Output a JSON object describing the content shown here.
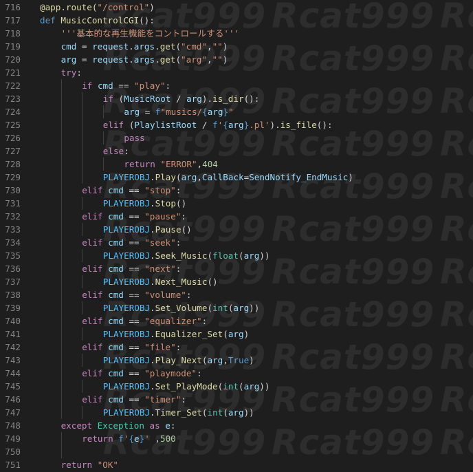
{
  "editor": {
    "language": "python",
    "watermark_text": "Rcat999",
    "colors": {
      "background": "#1e1e1e",
      "line_number": "#858585",
      "keyword": "#c586c0",
      "keyword_blue": "#569cd6",
      "function": "#dcdcaa",
      "class": "#4ec9b0",
      "variable": "#9cdcfe",
      "constant": "#4fc1ff",
      "string": "#ce9178",
      "number": "#b5cea8",
      "plain": "#d4d4d4"
    },
    "lines": [
      {
        "n": "716",
        "indent": 0,
        "tokens": [
          {
            "t": "@app.route(",
            "c": "dec"
          },
          {
            "t": "\"/control\"",
            "c": "str"
          },
          {
            "t": ")",
            "c": "op"
          }
        ]
      },
      {
        "n": "717",
        "indent": 0,
        "tokens": [
          {
            "t": "def ",
            "c": "kwb"
          },
          {
            "t": "MusicControlCGI",
            "c": "fn"
          },
          {
            "t": "():",
            "c": "op"
          }
        ]
      },
      {
        "n": "718",
        "indent": 1,
        "tokens": [
          {
            "t": "'''基本的な再生機能をコントロールする'''",
            "c": "str"
          }
        ]
      },
      {
        "n": "719",
        "indent": 1,
        "tokens": [
          {
            "t": "cmd",
            "c": "var"
          },
          {
            "t": " = ",
            "c": "op"
          },
          {
            "t": "request",
            "c": "var"
          },
          {
            "t": ".",
            "c": "op"
          },
          {
            "t": "args",
            "c": "var"
          },
          {
            "t": ".",
            "c": "op"
          },
          {
            "t": "get",
            "c": "fn"
          },
          {
            "t": "(",
            "c": "op"
          },
          {
            "t": "\"cmd\"",
            "c": "str"
          },
          {
            "t": ",",
            "c": "op"
          },
          {
            "t": "\"\"",
            "c": "str"
          },
          {
            "t": ")",
            "c": "op"
          }
        ]
      },
      {
        "n": "720",
        "indent": 1,
        "tokens": [
          {
            "t": "arg",
            "c": "var"
          },
          {
            "t": " = ",
            "c": "op"
          },
          {
            "t": "request",
            "c": "var"
          },
          {
            "t": ".",
            "c": "op"
          },
          {
            "t": "args",
            "c": "var"
          },
          {
            "t": ".",
            "c": "op"
          },
          {
            "t": "get",
            "c": "fn"
          },
          {
            "t": "(",
            "c": "op"
          },
          {
            "t": "\"arg\"",
            "c": "str"
          },
          {
            "t": ",",
            "c": "op"
          },
          {
            "t": "\"\"",
            "c": "str"
          },
          {
            "t": ")",
            "c": "op"
          }
        ]
      },
      {
        "n": "721",
        "indent": 1,
        "tokens": [
          {
            "t": "try",
            "c": "kw"
          },
          {
            "t": ":",
            "c": "op"
          }
        ]
      },
      {
        "n": "722",
        "indent": 2,
        "tokens": [
          {
            "t": "if ",
            "c": "kw"
          },
          {
            "t": "cmd",
            "c": "var"
          },
          {
            "t": " == ",
            "c": "op"
          },
          {
            "t": "\"play\"",
            "c": "str"
          },
          {
            "t": ":",
            "c": "op"
          }
        ]
      },
      {
        "n": "723",
        "indent": 3,
        "tokens": [
          {
            "t": "if ",
            "c": "kw"
          },
          {
            "t": "(",
            "c": "op"
          },
          {
            "t": "MusicRoot",
            "c": "var"
          },
          {
            "t": " / ",
            "c": "op"
          },
          {
            "t": "arg",
            "c": "var"
          },
          {
            "t": ").",
            "c": "op"
          },
          {
            "t": "is_dir",
            "c": "fn"
          },
          {
            "t": "():",
            "c": "op"
          }
        ]
      },
      {
        "n": "724",
        "indent": 4,
        "tokens": [
          {
            "t": "arg",
            "c": "var"
          },
          {
            "t": " = ",
            "c": "op"
          },
          {
            "t": "f",
            "c": "kwb"
          },
          {
            "t": "\"musics/",
            "c": "str"
          },
          {
            "t": "{",
            "c": "kwb"
          },
          {
            "t": "arg",
            "c": "var"
          },
          {
            "t": "}",
            "c": "kwb"
          },
          {
            "t": "\"",
            "c": "str"
          }
        ]
      },
      {
        "n": "725",
        "indent": 3,
        "tokens": [
          {
            "t": "elif ",
            "c": "kw"
          },
          {
            "t": "(",
            "c": "op"
          },
          {
            "t": "PlaylistRoot",
            "c": "var"
          },
          {
            "t": " / ",
            "c": "op"
          },
          {
            "t": "f",
            "c": "kwb"
          },
          {
            "t": "'",
            "c": "str"
          },
          {
            "t": "{",
            "c": "kwb"
          },
          {
            "t": "arg",
            "c": "var"
          },
          {
            "t": "}",
            "c": "kwb"
          },
          {
            "t": ".pl'",
            "c": "str"
          },
          {
            "t": ").",
            "c": "op"
          },
          {
            "t": "is_file",
            "c": "fn"
          },
          {
            "t": "():",
            "c": "op"
          }
        ]
      },
      {
        "n": "726",
        "indent": 4,
        "tokens": [
          {
            "t": "pass",
            "c": "kw"
          }
        ]
      },
      {
        "n": "727",
        "indent": 3,
        "tokens": [
          {
            "t": "else",
            "c": "kw"
          },
          {
            "t": ":",
            "c": "op"
          }
        ]
      },
      {
        "n": "728",
        "indent": 4,
        "tokens": [
          {
            "t": "return ",
            "c": "kw"
          },
          {
            "t": "\"ERROR\"",
            "c": "str"
          },
          {
            "t": ",",
            "c": "op"
          },
          {
            "t": "404",
            "c": "num"
          }
        ]
      },
      {
        "n": "729",
        "indent": 3,
        "tokens": [
          {
            "t": "PLAYEROBJ",
            "c": "const"
          },
          {
            "t": ".",
            "c": "op"
          },
          {
            "t": "Play",
            "c": "fn"
          },
          {
            "t": "(",
            "c": "op"
          },
          {
            "t": "arg",
            "c": "var"
          },
          {
            "t": ",",
            "c": "op"
          },
          {
            "t": "CallBack",
            "c": "var"
          },
          {
            "t": "=",
            "c": "op"
          },
          {
            "t": "SendNotify_EndMusic",
            "c": "var"
          },
          {
            "t": ")",
            "c": "op"
          }
        ]
      },
      {
        "n": "730",
        "indent": 2,
        "tokens": [
          {
            "t": "elif ",
            "c": "kw"
          },
          {
            "t": "cmd",
            "c": "var"
          },
          {
            "t": " == ",
            "c": "op"
          },
          {
            "t": "\"stop\"",
            "c": "str"
          },
          {
            "t": ":",
            "c": "op"
          }
        ]
      },
      {
        "n": "731",
        "indent": 3,
        "tokens": [
          {
            "t": "PLAYEROBJ",
            "c": "const"
          },
          {
            "t": ".",
            "c": "op"
          },
          {
            "t": "Stop",
            "c": "fn"
          },
          {
            "t": "()",
            "c": "op"
          }
        ]
      },
      {
        "n": "732",
        "indent": 2,
        "tokens": [
          {
            "t": "elif ",
            "c": "kw"
          },
          {
            "t": "cmd",
            "c": "var"
          },
          {
            "t": " == ",
            "c": "op"
          },
          {
            "t": "\"pause\"",
            "c": "str"
          },
          {
            "t": ":",
            "c": "op"
          }
        ]
      },
      {
        "n": "733",
        "indent": 3,
        "tokens": [
          {
            "t": "PLAYEROBJ",
            "c": "const"
          },
          {
            "t": ".",
            "c": "op"
          },
          {
            "t": "Pause",
            "c": "fn"
          },
          {
            "t": "()",
            "c": "op"
          }
        ]
      },
      {
        "n": "734",
        "indent": 2,
        "tokens": [
          {
            "t": "elif ",
            "c": "kw"
          },
          {
            "t": "cmd",
            "c": "var"
          },
          {
            "t": " == ",
            "c": "op"
          },
          {
            "t": "\"seek\"",
            "c": "str"
          },
          {
            "t": ":",
            "c": "op"
          }
        ]
      },
      {
        "n": "735",
        "indent": 3,
        "tokens": [
          {
            "t": "PLAYEROBJ",
            "c": "const"
          },
          {
            "t": ".",
            "c": "op"
          },
          {
            "t": "Seek_Music",
            "c": "fn"
          },
          {
            "t": "(",
            "c": "op"
          },
          {
            "t": "float",
            "c": "cls"
          },
          {
            "t": "(",
            "c": "op"
          },
          {
            "t": "arg",
            "c": "var"
          },
          {
            "t": "))",
            "c": "op"
          }
        ]
      },
      {
        "n": "736",
        "indent": 2,
        "tokens": [
          {
            "t": "elif ",
            "c": "kw"
          },
          {
            "t": "cmd",
            "c": "var"
          },
          {
            "t": " == ",
            "c": "op"
          },
          {
            "t": "\"next\"",
            "c": "str"
          },
          {
            "t": ":",
            "c": "op"
          }
        ]
      },
      {
        "n": "737",
        "indent": 3,
        "tokens": [
          {
            "t": "PLAYEROBJ",
            "c": "const"
          },
          {
            "t": ".",
            "c": "op"
          },
          {
            "t": "Next_Music",
            "c": "fn"
          },
          {
            "t": "()",
            "c": "op"
          }
        ]
      },
      {
        "n": "738",
        "indent": 2,
        "tokens": [
          {
            "t": "elif ",
            "c": "kw"
          },
          {
            "t": "cmd",
            "c": "var"
          },
          {
            "t": " == ",
            "c": "op"
          },
          {
            "t": "\"volume\"",
            "c": "str"
          },
          {
            "t": ":",
            "c": "op"
          }
        ]
      },
      {
        "n": "739",
        "indent": 3,
        "tokens": [
          {
            "t": "PLAYEROBJ",
            "c": "const"
          },
          {
            "t": ".",
            "c": "op"
          },
          {
            "t": "Set_Volume",
            "c": "fn"
          },
          {
            "t": "(",
            "c": "op"
          },
          {
            "t": "int",
            "c": "cls"
          },
          {
            "t": "(",
            "c": "op"
          },
          {
            "t": "arg",
            "c": "var"
          },
          {
            "t": "))",
            "c": "op"
          }
        ]
      },
      {
        "n": "740",
        "indent": 2,
        "tokens": [
          {
            "t": "elif ",
            "c": "kw"
          },
          {
            "t": "cmd",
            "c": "var"
          },
          {
            "t": " == ",
            "c": "op"
          },
          {
            "t": "\"equalizer\"",
            "c": "str"
          },
          {
            "t": ":",
            "c": "op"
          }
        ]
      },
      {
        "n": "741",
        "indent": 3,
        "tokens": [
          {
            "t": "PLAYEROBJ",
            "c": "const"
          },
          {
            "t": ".",
            "c": "op"
          },
          {
            "t": "Equalizer_Set",
            "c": "fn"
          },
          {
            "t": "(",
            "c": "op"
          },
          {
            "t": "arg",
            "c": "var"
          },
          {
            "t": ")",
            "c": "op"
          }
        ]
      },
      {
        "n": "742",
        "indent": 2,
        "tokens": [
          {
            "t": "elif ",
            "c": "kw"
          },
          {
            "t": "cmd",
            "c": "var"
          },
          {
            "t": " == ",
            "c": "op"
          },
          {
            "t": "\"file\"",
            "c": "str"
          },
          {
            "t": ":",
            "c": "op"
          }
        ]
      },
      {
        "n": "743",
        "indent": 3,
        "tokens": [
          {
            "t": "PLAYEROBJ",
            "c": "const"
          },
          {
            "t": ".",
            "c": "op"
          },
          {
            "t": "Play_Next",
            "c": "fn"
          },
          {
            "t": "(",
            "c": "op"
          },
          {
            "t": "arg",
            "c": "var"
          },
          {
            "t": ",",
            "c": "op"
          },
          {
            "t": "True",
            "c": "kwb"
          },
          {
            "t": ")",
            "c": "op"
          }
        ]
      },
      {
        "n": "744",
        "indent": 2,
        "tokens": [
          {
            "t": "elif ",
            "c": "kw"
          },
          {
            "t": "cmd",
            "c": "var"
          },
          {
            "t": " == ",
            "c": "op"
          },
          {
            "t": "\"playmode\"",
            "c": "str"
          },
          {
            "t": ":",
            "c": "op"
          }
        ]
      },
      {
        "n": "745",
        "indent": 3,
        "tokens": [
          {
            "t": "PLAYEROBJ",
            "c": "const"
          },
          {
            "t": ".",
            "c": "op"
          },
          {
            "t": "Set_PlayMode",
            "c": "fn"
          },
          {
            "t": "(",
            "c": "op"
          },
          {
            "t": "int",
            "c": "cls"
          },
          {
            "t": "(",
            "c": "op"
          },
          {
            "t": "arg",
            "c": "var"
          },
          {
            "t": "))",
            "c": "op"
          }
        ]
      },
      {
        "n": "746",
        "indent": 2,
        "tokens": [
          {
            "t": "elif ",
            "c": "kw"
          },
          {
            "t": "cmd",
            "c": "var"
          },
          {
            "t": " == ",
            "c": "op"
          },
          {
            "t": "\"timer\"",
            "c": "str"
          },
          {
            "t": ":",
            "c": "op"
          }
        ]
      },
      {
        "n": "747",
        "indent": 3,
        "tokens": [
          {
            "t": "PLAYEROBJ",
            "c": "const"
          },
          {
            "t": ".",
            "c": "op"
          },
          {
            "t": "Timer_Set",
            "c": "fn"
          },
          {
            "t": "(",
            "c": "op"
          },
          {
            "t": "int",
            "c": "cls"
          },
          {
            "t": "(",
            "c": "op"
          },
          {
            "t": "arg",
            "c": "var"
          },
          {
            "t": "))",
            "c": "op"
          }
        ]
      },
      {
        "n": "748",
        "indent": 1,
        "tokens": [
          {
            "t": "except ",
            "c": "kw"
          },
          {
            "t": "Exception",
            "c": "cls"
          },
          {
            "t": " as ",
            "c": "kw"
          },
          {
            "t": "e",
            "c": "var"
          },
          {
            "t": ":",
            "c": "op"
          }
        ]
      },
      {
        "n": "749",
        "indent": 2,
        "tokens": [
          {
            "t": "return ",
            "c": "kw"
          },
          {
            "t": "f",
            "c": "kwb"
          },
          {
            "t": "'",
            "c": "str"
          },
          {
            "t": "{",
            "c": "kwb"
          },
          {
            "t": "e",
            "c": "var"
          },
          {
            "t": "}",
            "c": "kwb"
          },
          {
            "t": "'",
            "c": "str"
          },
          {
            "t": " ,",
            "c": "op"
          },
          {
            "t": "500",
            "c": "num"
          }
        ]
      },
      {
        "n": "750",
        "indent": 0,
        "tokens": []
      },
      {
        "n": "751",
        "indent": 1,
        "tokens": [
          {
            "t": "return ",
            "c": "kw"
          },
          {
            "t": "\"OK\"",
            "c": "str"
          }
        ]
      }
    ]
  }
}
